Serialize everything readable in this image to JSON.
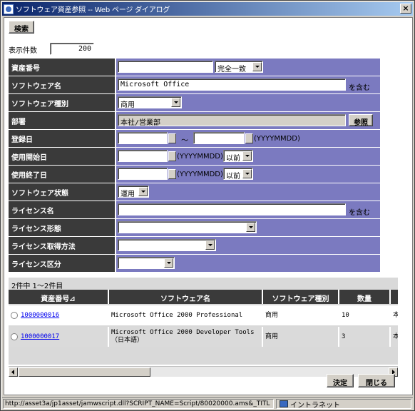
{
  "window": {
    "title": "ソフトウェア資産参照 -- Web ページ ダイアログ"
  },
  "toolbar": {
    "search_label": "検索"
  },
  "display_count": {
    "label": "表示件数",
    "value": "200"
  },
  "form": {
    "asset_no": {
      "label": "資産番号",
      "value": "",
      "match": "完全一致"
    },
    "software_name": {
      "label": "ソフトウェア名",
      "value": "Microsoft Office",
      "suffix": "を含む"
    },
    "software_type": {
      "label": "ソフトウェア種別",
      "value": "商用"
    },
    "department": {
      "label": "部署",
      "value": "本社/営業部",
      "button": "参照"
    },
    "register_date": {
      "label": "登録日",
      "tilde": "～",
      "format": "(YYYYMMDD)"
    },
    "start_date": {
      "label": "使用開始日",
      "format": "(YYYYMMDD)",
      "cond": "以前"
    },
    "end_date": {
      "label": "使用終了日",
      "format": "(YYYYMMDD)",
      "cond": "以前"
    },
    "software_state": {
      "label": "ソフトウェア状態",
      "value": "運用"
    },
    "license_name": {
      "label": "ライセンス名",
      "value": "",
      "suffix": "を含む"
    },
    "license_form": {
      "label": "ライセンス形態",
      "value": ""
    },
    "license_acquire": {
      "label": "ライセンス取得方法",
      "value": ""
    },
    "license_class": {
      "label": "ライセンス区分",
      "value": ""
    }
  },
  "results": {
    "summary": "2件中 1～2件目",
    "columns": [
      "資産番号⊿",
      "ソフトウェア名",
      "ソフトウェア種別",
      "数量",
      "本"
    ],
    "rows": [
      {
        "asset_no": "1000000016",
        "name": "Microsoft Office 2000 Professional",
        "type": "商用",
        "qty": "10",
        "extra": "本"
      },
      {
        "asset_no": "1000000017",
        "name": "Microsoft Office 2000 Developer Tools（日本語）",
        "type": "商用",
        "qty": "3",
        "extra": "本"
      }
    ]
  },
  "footer": {
    "ok_label": "決定",
    "close_label": "閉じる"
  },
  "statusbar": {
    "url": "http://asset3a/jp1asset/jamwscript.dll?SCRIPT_NAME=Script/80020000.ams&_TITL",
    "zone": "イントラネット"
  }
}
